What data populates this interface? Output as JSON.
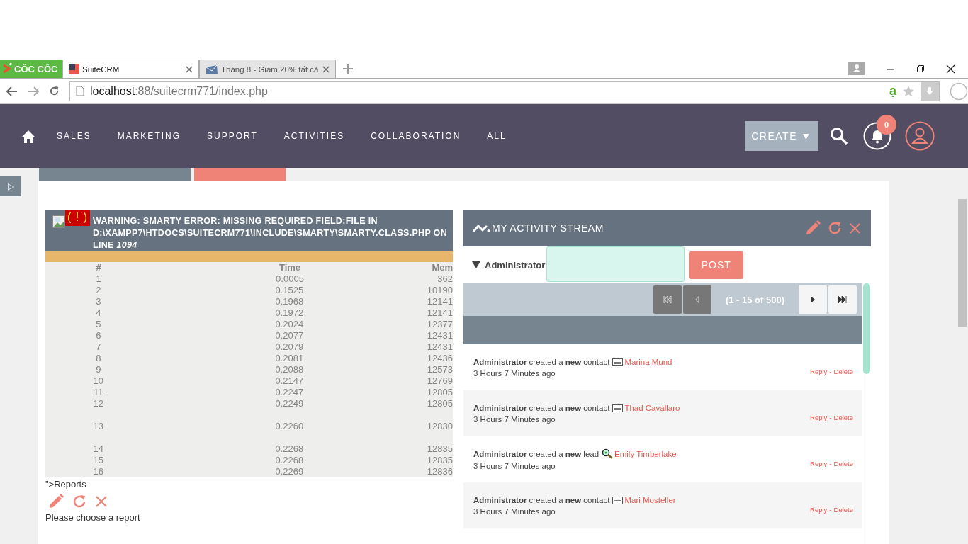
{
  "browser": {
    "logo": "CỐC CỐC",
    "tabs": [
      {
        "title": "SuiteCRM",
        "selected": true
      },
      {
        "title": "Tháng 8 - Giảm 20% tất cả",
        "selected": false
      }
    ],
    "url_host": "localhost",
    "url_path": ":88/suitecrm771/index.php",
    "ime_indicator": "ạ"
  },
  "nav": {
    "items": [
      "SALES",
      "MARKETING",
      "SUPPORT",
      "ACTIVITIES",
      "COLLABORATION",
      "ALL"
    ],
    "create_label": "CREATE",
    "create_caret": "▼",
    "notification_count": "0"
  },
  "sidebar_toggle": "▷",
  "left_dashlet": {
    "warning_badge": "( ! )",
    "warning": "WARNING: SMARTY ERROR: MISSING REQUIRED FIELD:FILE IN D:\\XAMPP7\\HTDOCS\\SUITECRM771\\INCLUDE\\SMARTY\\SMARTY.CLASS.PHP ON LINE *1094*",
    "columns": [
      "#",
      "Time",
      "Mem"
    ],
    "rows": [
      {
        "n": "1",
        "time": "0.0005",
        "mem": "362",
        "tall": false
      },
      {
        "n": "2",
        "time": "0.1525",
        "mem": "10190",
        "tall": false
      },
      {
        "n": "3",
        "time": "0.1968",
        "mem": "12141",
        "tall": false
      },
      {
        "n": "4",
        "time": "0.1972",
        "mem": "12141",
        "tall": false
      },
      {
        "n": "5",
        "time": "0.2024",
        "mem": "12377",
        "tall": false
      },
      {
        "n": "6",
        "time": "0.2077",
        "mem": "12431",
        "tall": false
      },
      {
        "n": "7",
        "time": "0.2079",
        "mem": "12431",
        "tall": false
      },
      {
        "n": "8",
        "time": "0.2081",
        "mem": "12436",
        "tall": false
      },
      {
        "n": "9",
        "time": "0.2088",
        "mem": "12573",
        "tall": false
      },
      {
        "n": "10",
        "time": "0.2147",
        "mem": "12769",
        "tall": false
      },
      {
        "n": "11",
        "time": "0.2247",
        "mem": "12805",
        "tall": false
      },
      {
        "n": "12",
        "time": "0.2249",
        "mem": "12805",
        "tall": false
      },
      {
        "n": "13",
        "time": "0.2260",
        "mem": "12830",
        "tall": true
      },
      {
        "n": "14",
        "time": "0.2268",
        "mem": "12835",
        "tall": false
      },
      {
        "n": "15",
        "time": "0.2268",
        "mem": "12835",
        "tall": false
      },
      {
        "n": "16",
        "time": "0.2269",
        "mem": "12836",
        "tall": false
      }
    ],
    "footer_text": "\">Reports",
    "message": "Please choose a report"
  },
  "activity_stream": {
    "title": "MY ACTIVITY STREAM",
    "user": "Administrator",
    "post_label": "POST",
    "pagination": "(1 - 15 of 500)",
    "items": [
      {
        "text": "**Administrator** created a **new** contact",
        "kind": "contact",
        "link": "Marina Mund",
        "time": "3 Hours 7 Minutes ago",
        "reply_label": "Reply",
        "separator": "-",
        "delete_label": "Delete"
      },
      {
        "text": "**Administrator** created a **new** contact",
        "kind": "contact",
        "link": "Thad Cavallaro",
        "time": "3 Hours 7 Minutes ago",
        "reply_label": "Reply",
        "separator": "-",
        "delete_label": "Delete"
      },
      {
        "text": "**Administrator** created a **new** lead",
        "kind": "lead",
        "link": "Emily Timberlake",
        "time": "3 Hours 7 Minutes ago",
        "reply_label": "Reply",
        "separator": "-",
        "delete_label": "Delete"
      },
      {
        "text": "**Administrator** created a **new** contact",
        "kind": "contact",
        "link": "Mari Mosteller",
        "time": "3 Hours 7 Minutes ago",
        "reply_label": "Reply",
        "separator": "-",
        "delete_label": "Delete"
      }
    ]
  }
}
